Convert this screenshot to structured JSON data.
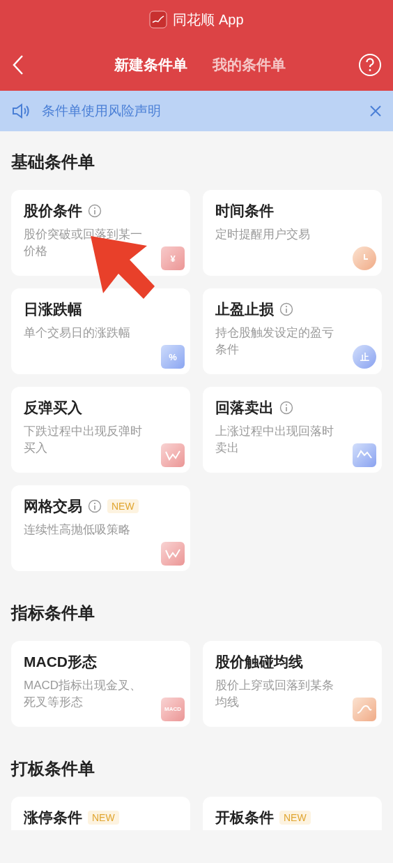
{
  "app_bar": {
    "title": "同花顺 App"
  },
  "tabs": [
    {
      "label": "新建条件单",
      "selected": true
    },
    {
      "label": "我的条件单",
      "selected": false
    }
  ],
  "notice": {
    "text": "条件单使用风险声明"
  },
  "sections": [
    {
      "title": "基础条件单",
      "cards": [
        {
          "title": "股价条件",
          "info": true,
          "desc": "股价突破或回落到某一价格",
          "kind": "price",
          "icon_label": "¥"
        },
        {
          "title": "时间条件",
          "info": false,
          "desc": "定时提醒用户交易",
          "kind": "clock"
        },
        {
          "title": "日涨跌幅",
          "info": false,
          "desc": "单个交易日的涨跌幅",
          "kind": "calendar",
          "icon_label": "%"
        },
        {
          "title": "止盈止损",
          "info": true,
          "desc": "持仓股触发设定的盈亏条件",
          "kind": "stop",
          "icon_label": "止"
        },
        {
          "title": "反弹买入",
          "info": false,
          "desc": "下跌过程中出现反弹时买入",
          "kind": "rebound"
        },
        {
          "title": "回落卖出",
          "info": true,
          "desc": "上涨过程中出现回落时卖出",
          "kind": "fall"
        },
        {
          "title": "网格交易",
          "info": true,
          "badge": "NEW",
          "desc": "连续性高抛低吸策略",
          "kind": "grid"
        }
      ]
    },
    {
      "title": "指标条件单",
      "cards": [
        {
          "title": "MACD形态",
          "info": false,
          "desc": "MACD指标出现金叉、死叉等形态",
          "kind": "macd",
          "icon_label": "MACD"
        },
        {
          "title": "股价触碰均线",
          "info": false,
          "desc": "股价上穿或回落到某条均线",
          "kind": "ma"
        }
      ]
    },
    {
      "title": "打板条件单",
      "cards": [
        {
          "title": "涨停条件",
          "info": false,
          "badge": "NEW",
          "kind": "short"
        },
        {
          "title": "开板条件",
          "info": false,
          "badge": "NEW",
          "kind": "short"
        }
      ]
    }
  ],
  "annotation": {
    "kind": "arrow"
  }
}
